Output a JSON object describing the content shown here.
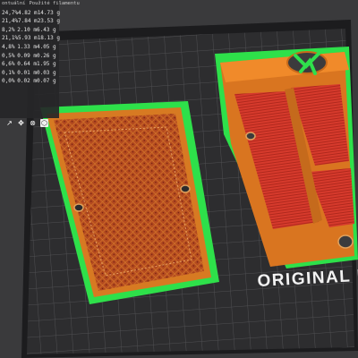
{
  "legend": {
    "col_time": "ontuální",
    "col_filament": "Použité filamentu",
    "rows": [
      {
        "pct": "24,7%",
        "len": "4.82 m",
        "wt": "14.73 g"
      },
      {
        "pct": "21,4%",
        "len": "7.84 m",
        "wt": "23.53 g"
      },
      {
        "pct": "8,2%",
        "len": "2.10 m",
        "wt": "6.43 g"
      },
      {
        "pct": "21,1%",
        "len": "5.93 m",
        "wt": "18.13 g"
      },
      {
        "pct": "4,8%",
        "len": "1.33 m",
        "wt": "4.05 g"
      },
      {
        "pct": "0,5%",
        "len": "0.09 m",
        "wt": "0.26 g"
      },
      {
        "pct": "6,6%",
        "len": "0.64 m",
        "wt": "1.95 g"
      },
      {
        "pct": "0,1%",
        "len": "0.01 m",
        "wt": "0.03 g"
      },
      {
        "pct": "0,0%",
        "len": "0.02 m",
        "wt": "0.07 g"
      }
    ],
    "swatches": [
      "#ff7f00",
      "#ff7f00",
      "#ff3333",
      "#cc0000",
      "#a0a0ff",
      "#5b5bff",
      "#33cc33",
      "#7fff00",
      "#ffffff"
    ]
  },
  "toolbar": {
    "icons": [
      "select-icon",
      "move-icon",
      "cut-icon",
      "cube-icon"
    ],
    "glyphs": [
      "↗",
      "✥",
      "⊗",
      "⬡"
    ]
  },
  "bed": {
    "label": "ORIGINAL PRI"
  },
  "colors": {
    "bed_bg": "#2b2b2d",
    "grid_line": "#4a4a4c",
    "frame": "#141414",
    "skirt": "#2fe04c",
    "perimeter": "#d9781e",
    "infill": "#c73a2a",
    "infill_dots": "#8b2a1e"
  }
}
